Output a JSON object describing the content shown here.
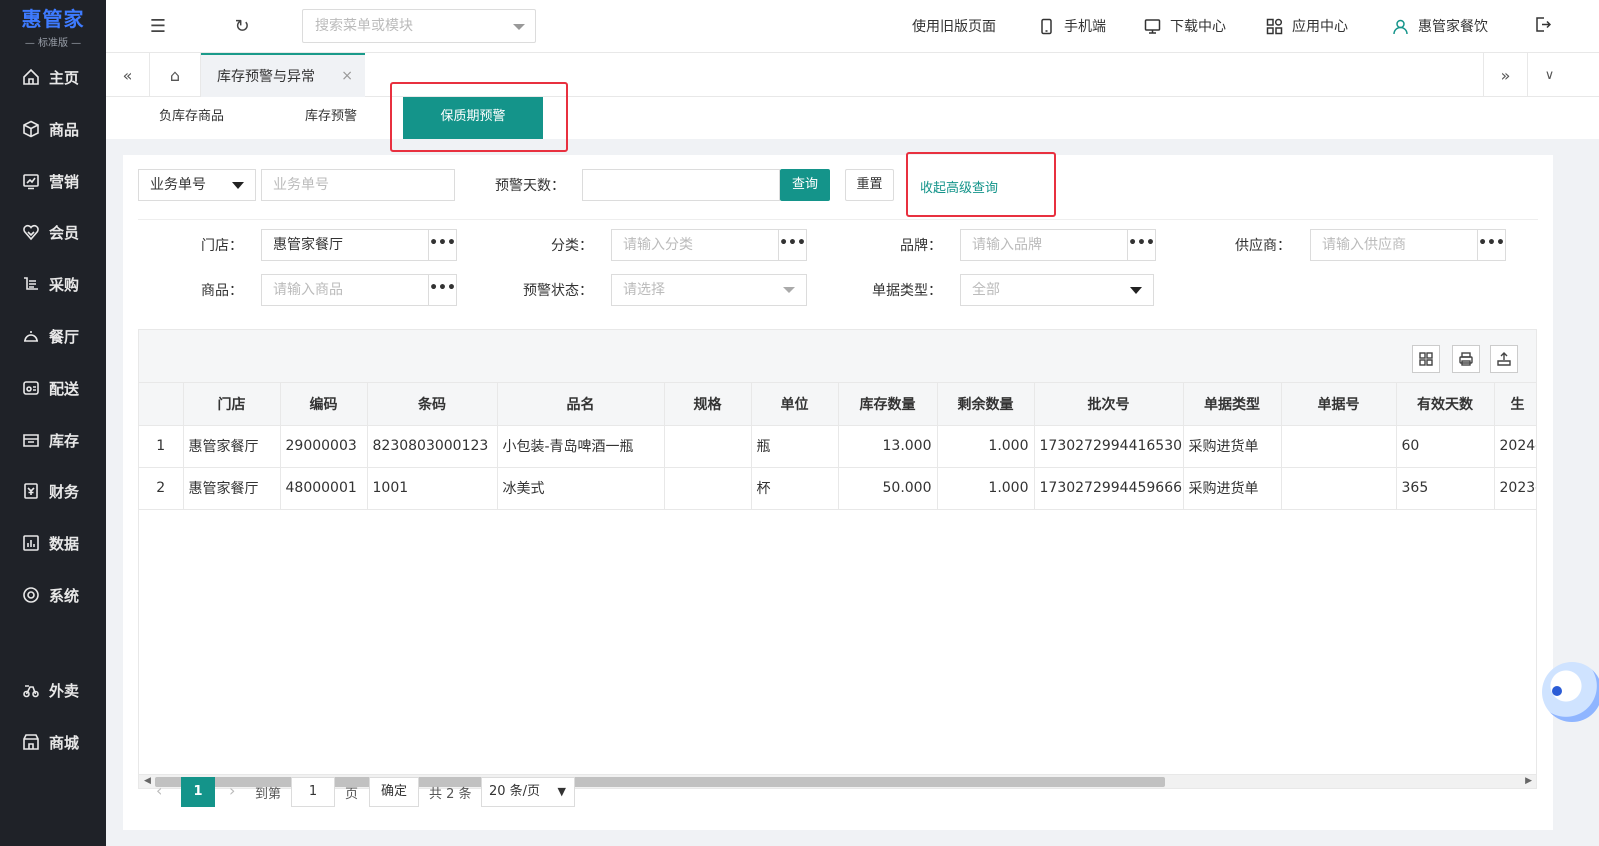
{
  "brand": {
    "name": "惠管家",
    "edition": "— 标准版 —",
    "color": "#3e7bff"
  },
  "sidebar": {
    "items": [
      {
        "label": "主页",
        "icon": "home-icon"
      },
      {
        "label": "商品",
        "icon": "box-icon"
      },
      {
        "label": "营销",
        "icon": "chart-icon"
      },
      {
        "label": "会员",
        "icon": "heart-icon"
      },
      {
        "label": "采购",
        "icon": "purchase-icon"
      },
      {
        "label": "餐厅",
        "icon": "restaurant-icon"
      },
      {
        "label": "配送",
        "icon": "delivery-icon"
      },
      {
        "label": "库存",
        "icon": "inventory-icon"
      },
      {
        "label": "财务",
        "icon": "finance-icon"
      },
      {
        "label": "数据",
        "icon": "data-icon"
      },
      {
        "label": "系统",
        "icon": "settings-icon"
      },
      {
        "label": "外卖",
        "icon": "takeaway-icon"
      },
      {
        "label": "商城",
        "icon": "store-icon"
      }
    ]
  },
  "topbar": {
    "search_placeholder": "搜索菜单或模块",
    "old_version": "使用旧版页面",
    "mobile": "手机端",
    "download": "下载中心",
    "apps": "应用中心",
    "user": "惠管家餐饮"
  },
  "tabbar": {
    "open_tab": "库存预警与异常",
    "close": "×"
  },
  "subtabs": {
    "negative": "负库存商品",
    "stock_warning": "库存预警",
    "shelf_life": "保质期预警"
  },
  "filters": {
    "doc_type_select": "业务单号",
    "doc_no_placeholder": "业务单号",
    "warn_days_label": "预警天数：",
    "query": "查询",
    "reset": "重置",
    "collapse": "收起高级查询",
    "store_label": "门店：",
    "store_value": "惠管家餐厅",
    "category_label": "分类：",
    "category_placeholder": "请输入分类",
    "brand_label": "品牌：",
    "brand_placeholder": "请输入品牌",
    "supplier_label": "供应商：",
    "supplier_placeholder": "请输入供应商",
    "goods_label": "商品：",
    "goods_placeholder": "请输入商品",
    "status_label": "预警状态：",
    "status_placeholder": "请选择",
    "bill_type_label": "单据类型：",
    "bill_type_value": "全部",
    "dots": "•••"
  },
  "table": {
    "headers": [
      "",
      "门店",
      "编码",
      "条码",
      "品名",
      "规格",
      "单位",
      "库存数量",
      "剩余数量",
      "批次号",
      "单据类型",
      "单据号",
      "有效天数",
      "生"
    ],
    "rows": [
      [
        "1",
        "惠管家餐厅",
        "29000003",
        "8230803000123",
        "小包装-青岛啤酒一瓶",
        "",
        "瓶",
        "13.000",
        "1.000",
        "1730272994416530",
        "采购进货单",
        "",
        "60",
        "2024-"
      ],
      [
        "2",
        "惠管家餐厅",
        "48000001",
        "1001",
        "冰美式",
        "",
        "杯",
        "50.000",
        "1.000",
        "1730272994459666",
        "采购进货单",
        "",
        "365",
        "2023-"
      ]
    ]
  },
  "pager": {
    "current": "1",
    "goto": "到第",
    "page_input": "1",
    "page": "页",
    "confirm": "确定",
    "total": "共 2 条",
    "page_size": "20 条/页"
  }
}
